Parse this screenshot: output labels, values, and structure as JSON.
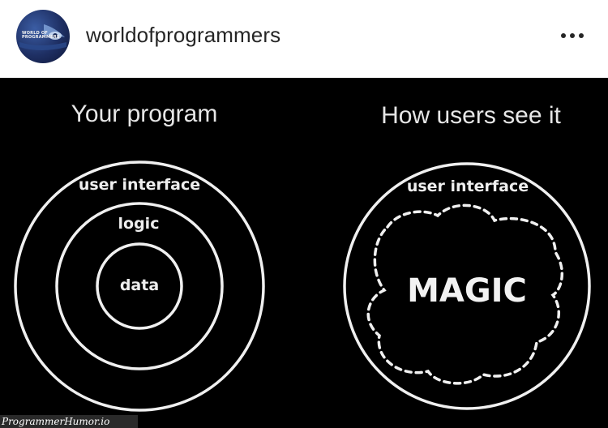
{
  "post": {
    "avatar_text": "WORLD OF\nPROGRAMMERS",
    "username": "worldofprogrammers",
    "more_icon": "more-horizontal-icon"
  },
  "meme": {
    "left_title": "Your program",
    "right_title": "How users see it",
    "left_rings": [
      "user interface",
      "logic",
      "data"
    ],
    "right_outer_label": "user interface",
    "right_center_label": "MAGIC"
  },
  "watermark": {
    "text": "ProgrammerHumor.io"
  },
  "colors": {
    "header_bg": "#ffffff",
    "username": "#262626",
    "image_bg": "#000000",
    "line": "#f0f0f0"
  }
}
